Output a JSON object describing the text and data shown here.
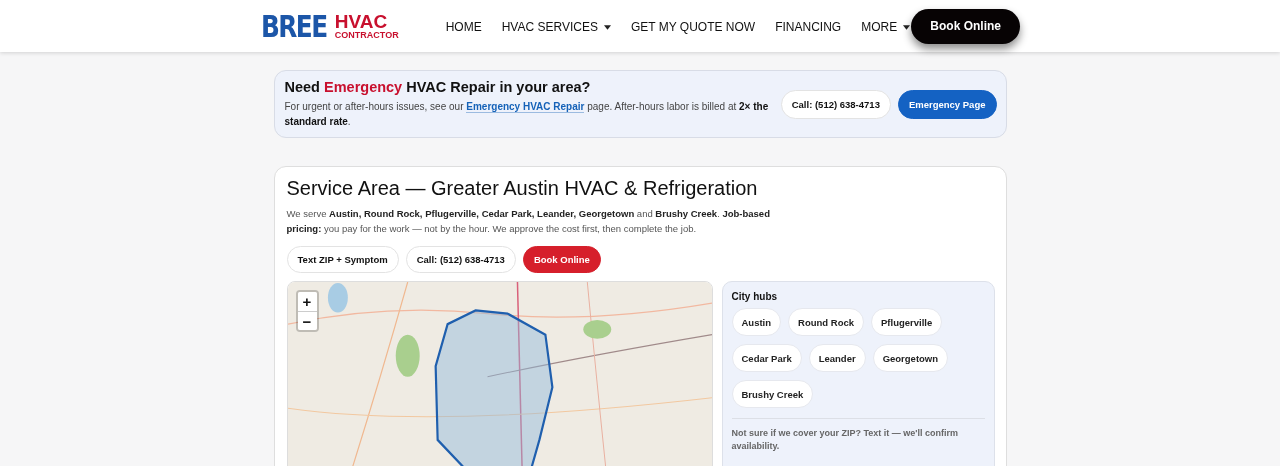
{
  "header": {
    "logo": {
      "word": "BREE",
      "hvac": "HVAC",
      "sub": "CONTRACTOR"
    },
    "nav": [
      {
        "label": "HOME",
        "dropdown": false
      },
      {
        "label": "HVAC SERVICES",
        "dropdown": true
      },
      {
        "label": "GET MY QUOTE NOW",
        "dropdown": false
      },
      {
        "label": "FINANCING",
        "dropdown": false
      },
      {
        "label": "MORE",
        "dropdown": true
      }
    ],
    "cta": "Book Online"
  },
  "notice": {
    "title_before": "Need",
    "title_highlight": "Emergency",
    "title_after": "HVAC Repair in your area?",
    "text_before": "For urgent or after-hours issues, see our",
    "link": "Emergency HVAC Repair",
    "text_after": "page. After-hours labor is billed at **2× the standard rate**.",
    "buttons": [
      {
        "label": "Call: (512) 638-4713",
        "kind": "outline"
      },
      {
        "label": "Emergency Page",
        "kind": "primary"
      }
    ]
  },
  "service_area": {
    "title": "Service Area — Greater Austin HVAC & Refrigeration",
    "intro": "We serve **Austin, Round Rock, Pflugerville, Cedar Park, Leander, Georgetown** and **Brushy Creek**. **Job-based pricing:** you pay for the work — not by the hour. We approve the cost first, then complete the job.",
    "buttons": [
      {
        "label": "Text ZIP + Symptom",
        "kind": "outline"
      },
      {
        "label": "Call: (512) 638-4713",
        "kind": "outline"
      },
      {
        "label": "Book Online",
        "kind": "danger"
      }
    ],
    "map": {
      "zoom_in": "+",
      "zoom_out": "−"
    },
    "hubs": {
      "title": "City hubs",
      "cities": [
        "Austin",
        "Round Rock",
        "Pflugerville",
        "Cedar Park",
        "Leander",
        "Georgetown",
        "Brushy Creek"
      ],
      "note": "Not sure if we cover your ZIP? Text it — we'll confirm availability."
    }
  }
}
